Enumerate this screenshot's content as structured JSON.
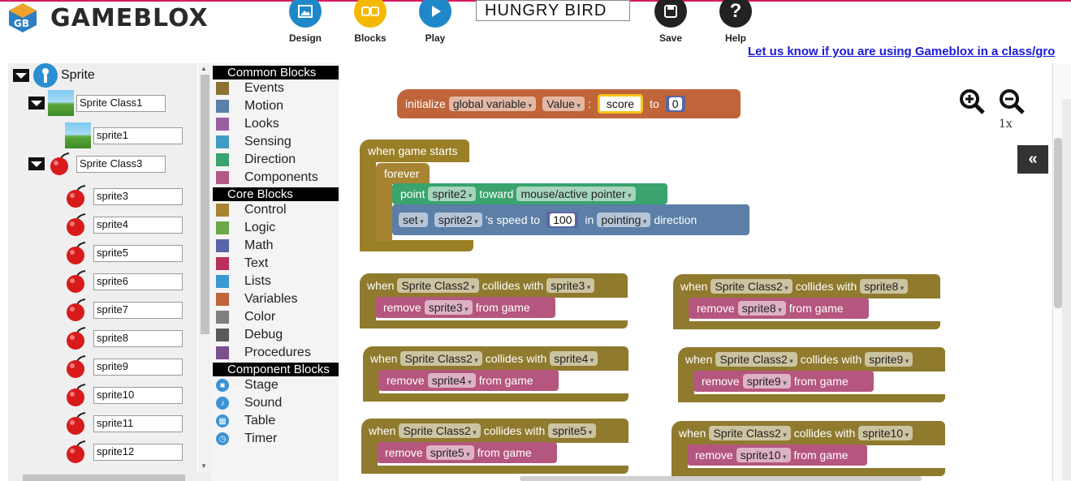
{
  "app": {
    "name": "GAMEBLOX",
    "project_title": "HUNGRY BIRD"
  },
  "toolbar": {
    "design": "Design",
    "blocks": "Blocks",
    "play": "Play",
    "save": "Save",
    "help": "Help",
    "colors": {
      "design": "#1e88c8",
      "blocks": "#f5b800",
      "play": "#1e88c8",
      "save": "#222222",
      "help": "#222222"
    }
  },
  "banner": {
    "class_link": "Let us know if you are using Gameblox in a class/gro"
  },
  "sprites": {
    "root": "Sprite",
    "classes": [
      {
        "name": "Sprite Class1",
        "children": [
          "sprite1"
        ]
      },
      {
        "name": "Sprite Class3",
        "children": [
          "sprite3",
          "sprite4",
          "sprite5",
          "sprite6",
          "sprite7",
          "sprite8",
          "sprite9",
          "sprite10",
          "sprite11",
          "sprite12"
        ]
      }
    ]
  },
  "categories": {
    "common_header": "Common Blocks",
    "common": [
      {
        "label": "Events",
        "color": "#8b7232"
      },
      {
        "label": "Motion",
        "color": "#5b7fa6"
      },
      {
        "label": "Looks",
        "color": "#9a5fa1"
      },
      {
        "label": "Sensing",
        "color": "#3f9bc4"
      },
      {
        "label": "Direction",
        "color": "#3aa36e"
      },
      {
        "label": "Components",
        "color": "#b05a85"
      }
    ],
    "core_header": "Core Blocks",
    "core": [
      {
        "label": "Control",
        "color": "#a68432"
      },
      {
        "label": "Logic",
        "color": "#6aa84a"
      },
      {
        "label": "Math",
        "color": "#5b64a8"
      },
      {
        "label": "Text",
        "color": "#b8325a"
      },
      {
        "label": "Lists",
        "color": "#3a9ad1"
      },
      {
        "label": "Variables",
        "color": "#c0653a"
      },
      {
        "label": "Color",
        "color": "#7f7f7f"
      },
      {
        "label": "Debug",
        "color": "#595959"
      },
      {
        "label": "Procedures",
        "color": "#7b4f8c"
      }
    ],
    "component_header": "Component Blocks",
    "component": [
      {
        "label": "Stage",
        "icon": "stage-icon"
      },
      {
        "label": "Sound",
        "icon": "sound-icon"
      },
      {
        "label": "Table",
        "icon": "table-icon"
      },
      {
        "label": "Timer",
        "icon": "timer-icon"
      }
    ]
  },
  "workspace": {
    "zoom": "1x",
    "collapse": "«",
    "init_block": {
      "initialize": "initialize",
      "scope": "global variable",
      "type": "Value",
      "colon": ":",
      "var": "score",
      "to": "to",
      "val": "0"
    },
    "game_start": {
      "event": "when game starts",
      "loop": "forever",
      "point": "point",
      "point_sprite": "sprite2",
      "toward": "toward",
      "target": "mouse/active pointer",
      "set": "set",
      "set_sprite": "sprite2",
      "speed_to": "'s speed to",
      "speed": "100",
      "in": "in",
      "dir": "pointing",
      "direction": "direction"
    },
    "collisions": [
      {
        "when": "when",
        "cls": "Sprite Class2",
        "collides": "collides with",
        "target": "sprite3",
        "remove": "remove",
        "from": "from game"
      },
      {
        "when": "when",
        "cls": "Sprite Class2",
        "collides": "collides with",
        "target": "sprite8",
        "remove": "remove",
        "from": "from game"
      },
      {
        "when": "when",
        "cls": "Sprite Class2",
        "collides": "collides with",
        "target": "sprite4",
        "remove": "remove",
        "from": "from game"
      },
      {
        "when": "when",
        "cls": "Sprite Class2",
        "collides": "collides with",
        "target": "sprite9",
        "remove": "remove",
        "from": "from game"
      },
      {
        "when": "when",
        "cls": "Sprite Class2",
        "collides": "collides with",
        "target": "sprite5",
        "remove": "remove",
        "from": "from game"
      },
      {
        "when": "when",
        "cls": "Sprite Class2",
        "collides": "collides with",
        "target": "sprite10",
        "remove": "remove",
        "from": "from game"
      }
    ]
  }
}
